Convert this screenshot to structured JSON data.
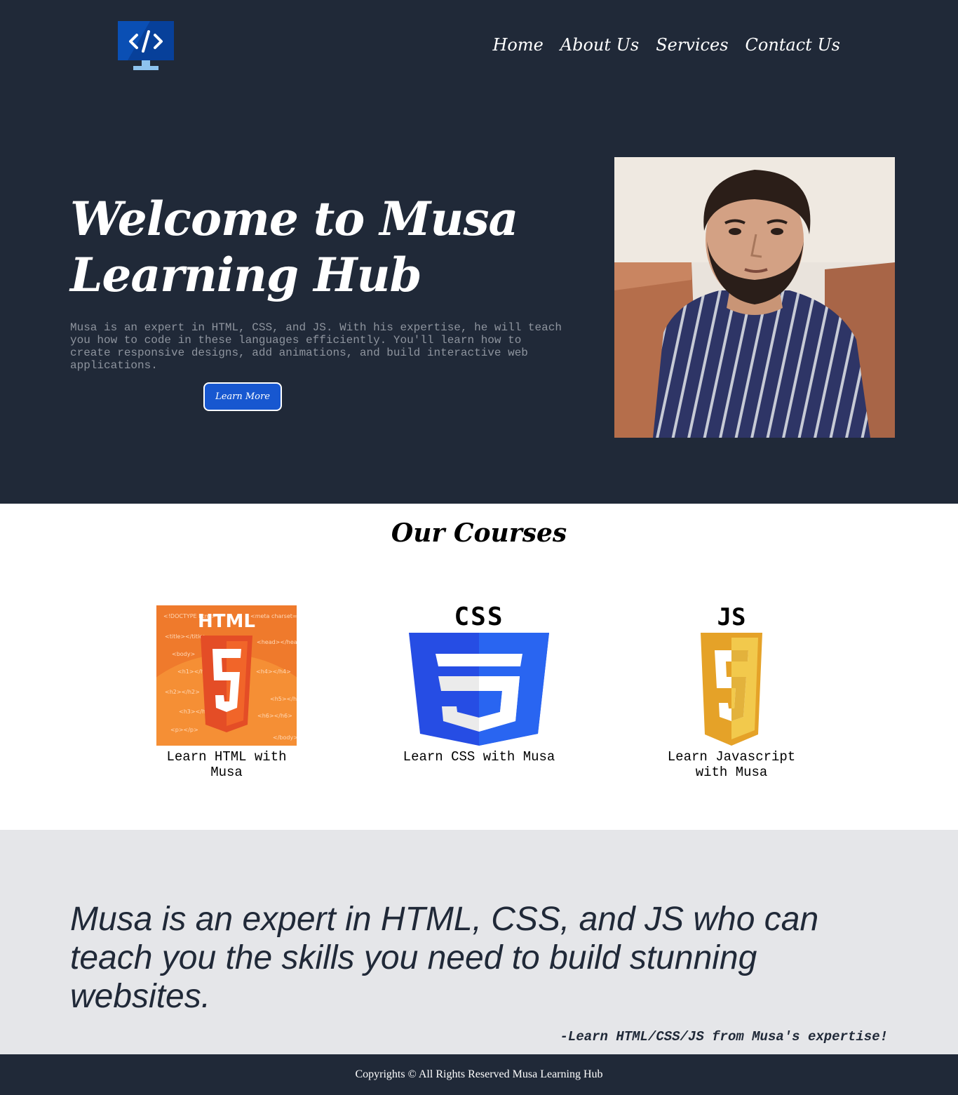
{
  "header": {
    "logo_icon": "code-monitor-icon",
    "nav": [
      {
        "label": "Home"
      },
      {
        "label": "About Us"
      },
      {
        "label": "Services"
      },
      {
        "label": "Contact Us"
      }
    ]
  },
  "hero": {
    "title": "Welcome to Musa Learning Hub",
    "text": "Musa is an expert in HTML, CSS, and JS. With his expertise, he will teach you how to code in these languages efficiently. You'll learn how to create responsive designs, add animations, and build interactive web applications.",
    "button_label": "Learn More",
    "portrait_icon": "portrait-photo"
  },
  "courses": {
    "title": "Our Courses",
    "items": [
      {
        "label": "Learn HTML with Musa",
        "icon": "html5-logo",
        "logo_text": "HTML"
      },
      {
        "label": "Learn CSS with Musa",
        "icon": "css3-logo",
        "logo_text": "CSS"
      },
      {
        "label": "Learn Javascript with Musa",
        "icon": "js-logo",
        "logo_text": "JS"
      }
    ]
  },
  "quote": {
    "text": "Musa is an expert in HTML, CSS, and JS who can teach you the skills you need to build stunning websites.",
    "signature": "-Learn HTML/CSS/JS from Musa's expertise!"
  },
  "footer": {
    "text": "Copyrights © All Rights Reserved Musa Learning Hub"
  },
  "colors": {
    "dark": "#202938",
    "accent": "#1757d0",
    "light": "#e5e6e9"
  }
}
